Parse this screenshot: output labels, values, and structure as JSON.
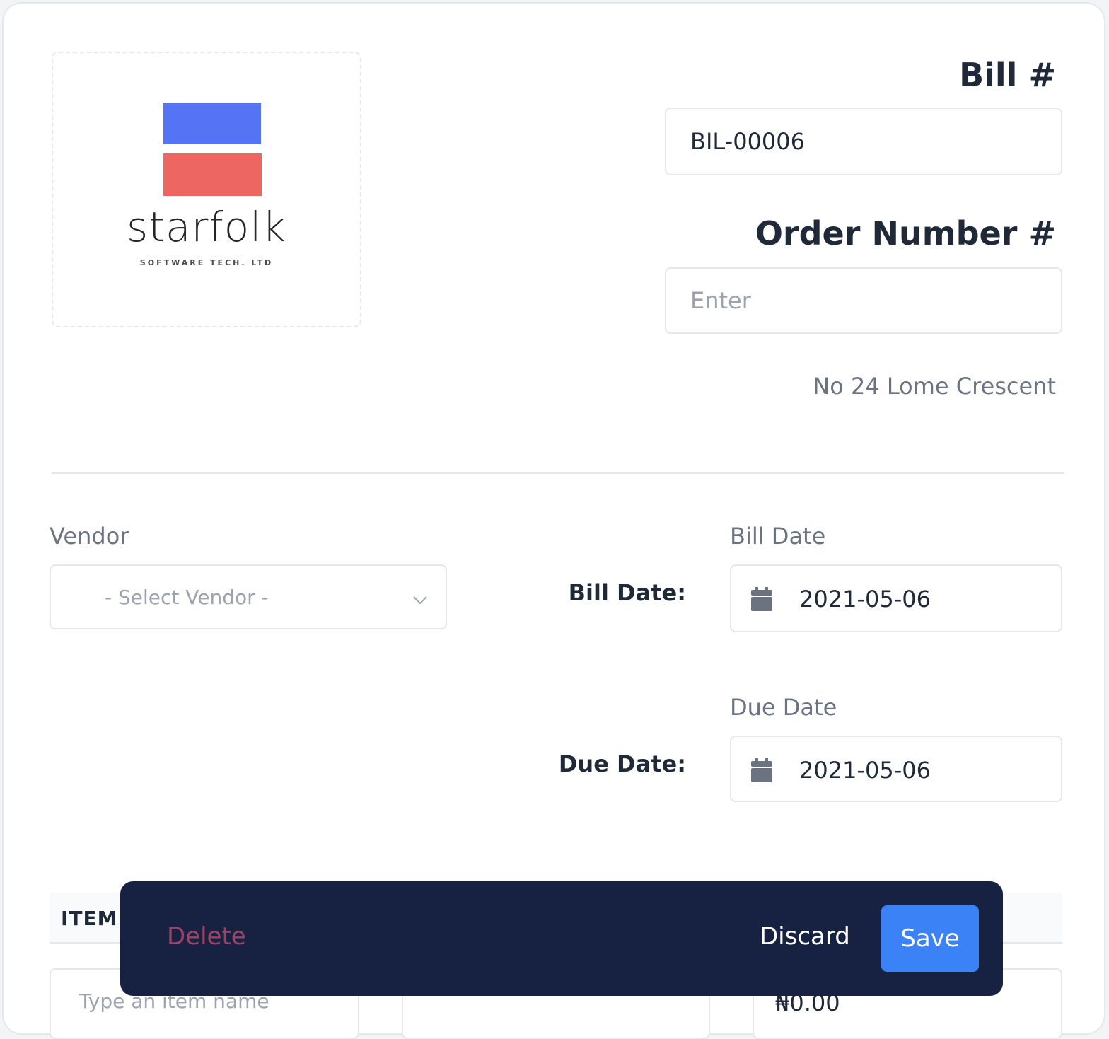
{
  "logo": {
    "brand_word": "starfolk",
    "brand_sub": "SOFTWARE TECH. LTD",
    "colors": {
      "blue": "#5574f5",
      "red": "#ed6661"
    }
  },
  "bill": {
    "heading": "Bill #",
    "number_value": "BIL-00006"
  },
  "order": {
    "heading": "Order Number #",
    "placeholder": "Enter"
  },
  "address": "No 24 Lome Crescent",
  "vendor": {
    "label": "Vendor",
    "placeholder": "- Select Vendor -"
  },
  "bill_date": {
    "top_label": "Bill Date",
    "side_label": "Bill Date:",
    "value": "2021-05-06",
    "icon": "calendar-icon"
  },
  "due_date": {
    "top_label": "Due Date",
    "side_label": "Due Date:",
    "value": "2021-05-06",
    "icon": "calendar-icon"
  },
  "items_table": {
    "headers": [
      "ITEM"
    ],
    "row": {
      "item_placeholder": "Type an item name",
      "amount": "₦0.00"
    }
  },
  "actions": {
    "delete_label": "Delete",
    "discard_label": "Discard",
    "save_label": "Save",
    "colors": {
      "bar": "#172141",
      "save": "#3b82f6",
      "delete": "#9b4266"
    }
  }
}
